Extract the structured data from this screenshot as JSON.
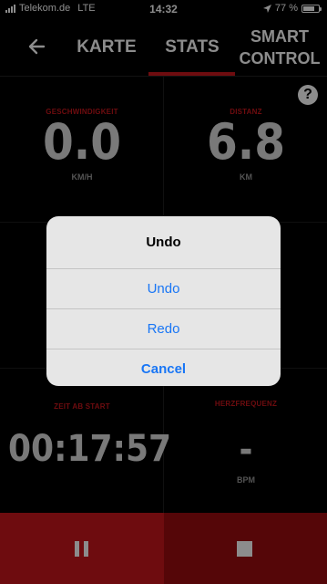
{
  "status_bar": {
    "carrier": "Telekom.de",
    "network": "LTE",
    "time": "14:32",
    "battery_text": "77 %",
    "battery_level_percent": 77
  },
  "nav": {
    "back_icon": "arrow-left-icon",
    "tabs": [
      {
        "label": "KARTE"
      },
      {
        "label": "STATS",
        "active": true
      },
      {
        "label": "SMART\nCONTROL"
      }
    ],
    "accent_color": "#c8161c"
  },
  "help_label": "?",
  "stats": {
    "speed": {
      "label": "GESCHWINDIGKEIT",
      "value": "0.0",
      "unit": "KM/H"
    },
    "distance": {
      "label": "DISTANZ",
      "value": "6.8",
      "unit": "KM"
    },
    "elapsed": {
      "label": "ZEIT AB START",
      "value": "00:17:57"
    },
    "heart_rate": {
      "label": "HERZFREQUENZ",
      "value": "-",
      "unit": "BPM"
    }
  },
  "controls": {
    "pause_icon": "pause-icon",
    "stop_icon": "stop-icon",
    "pause_color": "#c8161c",
    "stop_color": "#9b0b0f"
  },
  "dialog": {
    "title": "Undo",
    "actions": [
      {
        "label": "Undo"
      },
      {
        "label": "Redo"
      },
      {
        "label": "Cancel"
      }
    ],
    "action_color": "#1976f5"
  }
}
